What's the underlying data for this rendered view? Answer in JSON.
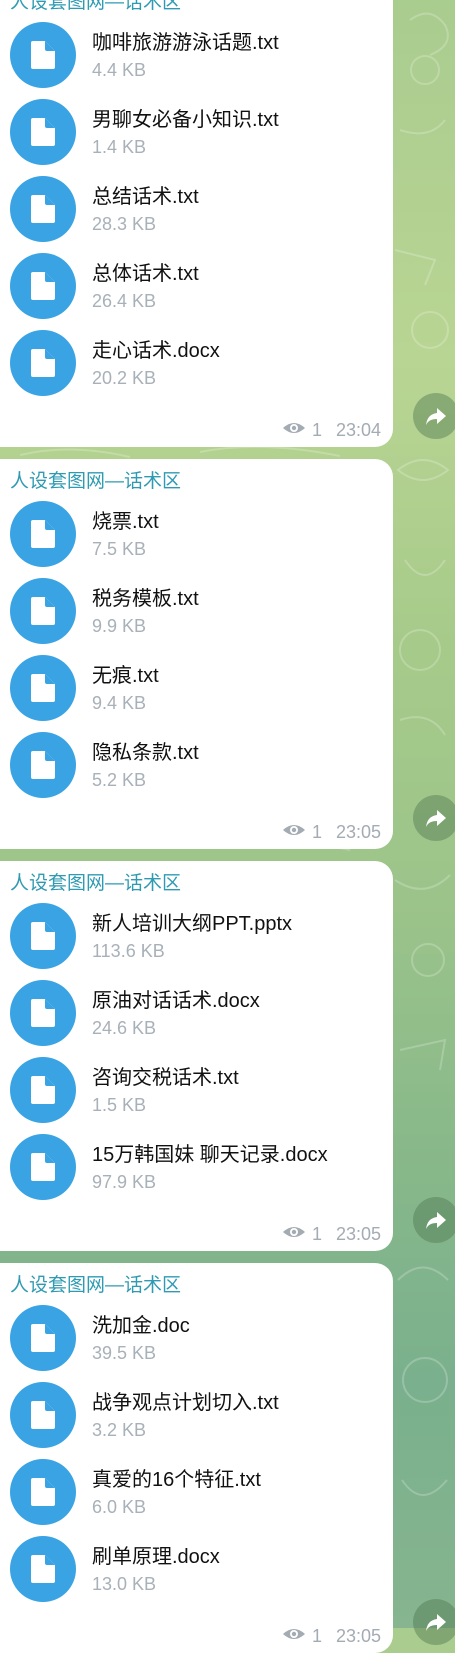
{
  "messages": [
    {
      "sender": "人设套图网—话术区",
      "files": [
        {
          "name": "咖啡旅游游泳话题.txt",
          "size": "4.4 KB"
        },
        {
          "name": "男聊女必备小知识.txt",
          "size": "1.4 KB"
        },
        {
          "name": "总结话术.txt",
          "size": "28.3 KB"
        },
        {
          "name": "总体话术.txt",
          "size": "26.4 KB"
        },
        {
          "name": "走心话术.docx",
          "size": "20.2 KB"
        }
      ],
      "views": "1",
      "time": "23:04"
    },
    {
      "sender": "人设套图网—话术区",
      "files": [
        {
          "name": "烧票.txt",
          "size": "7.5 KB"
        },
        {
          "name": "税务模板.txt",
          "size": "9.9 KB"
        },
        {
          "name": "无痕.txt",
          "size": "9.4 KB"
        },
        {
          "name": "隐私条款.txt",
          "size": "5.2 KB"
        }
      ],
      "views": "1",
      "time": "23:05"
    },
    {
      "sender": "人设套图网—话术区",
      "files": [
        {
          "name": "新人培训大纲PPT.pptx",
          "size": "113.6 KB"
        },
        {
          "name": "原油对话话术.docx",
          "size": "24.6 KB"
        },
        {
          "name": "咨询交税话术.txt",
          "size": "1.5 KB"
        },
        {
          "name": "15万韩国妹 聊天记录.docx",
          "size": "97.9 KB"
        }
      ],
      "views": "1",
      "time": "23:05"
    },
    {
      "sender": "人设套图网—话术区",
      "files": [
        {
          "name": "洗加金.doc",
          "size": "39.5 KB"
        },
        {
          "name": "战争观点计划切入.txt",
          "size": "3.2 KB"
        },
        {
          "name": "真爱的16个特征.txt",
          "size": "6.0 KB"
        },
        {
          "name": "刷单原理.docx",
          "size": "13.0 KB"
        }
      ],
      "views": "1",
      "time": "23:05"
    }
  ],
  "icons": {
    "file": "file-icon",
    "views": "eye-icon",
    "share": "share-icon"
  },
  "colors": {
    "sender": "#2f9bb3",
    "file_icon_bg": "#3aa3e3",
    "meta": "#a3abb3"
  }
}
